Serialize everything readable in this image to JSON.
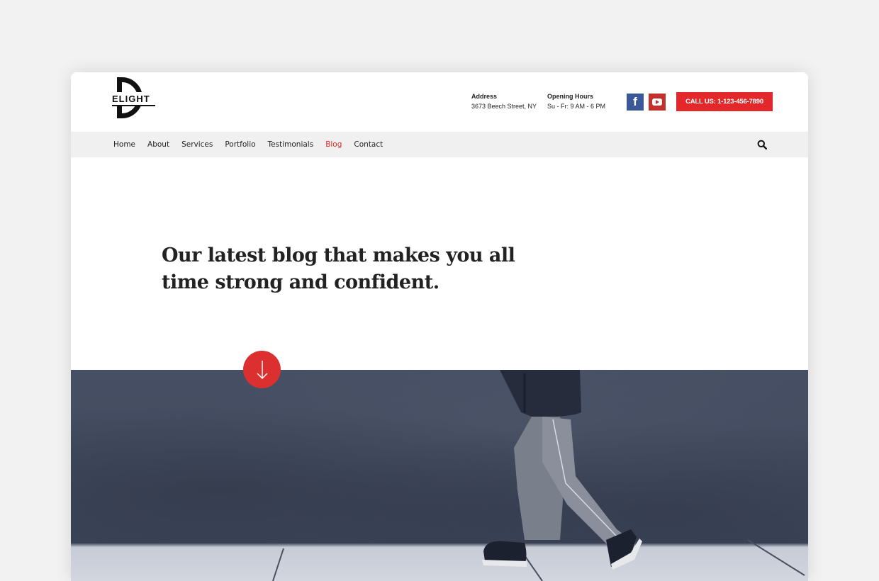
{
  "brand": {
    "logo_text": "ELIGHT",
    "logo_letter": "D"
  },
  "header": {
    "address": {
      "label": "Address",
      "value": "3673 Beech Street, NY"
    },
    "hours": {
      "label": "Opening Hours",
      "value": "Su - Fr: 9 AM - 6 PM"
    },
    "social": [
      {
        "name": "facebook-icon",
        "glyph": "f"
      },
      {
        "name": "youtube-icon",
        "glyph": ""
      }
    ],
    "call_button": "CALL US: 1-123-456-7890"
  },
  "nav": {
    "items": [
      {
        "label": "Home",
        "active": false
      },
      {
        "label": "About",
        "active": false
      },
      {
        "label": "Services",
        "active": false
      },
      {
        "label": "Portfolio",
        "active": false
      },
      {
        "label": "Testimonials",
        "active": false
      },
      {
        "label": "Blog",
        "active": true
      },
      {
        "label": "Contact",
        "active": false
      }
    ],
    "search_icon": "search-icon"
  },
  "hero": {
    "title_line1": "Our latest blog that makes you all",
    "title_line2": "time strong and confident.",
    "scroll_icon": "arrow-down-icon"
  },
  "colors": {
    "accent": "#e3282b",
    "facebook": "#3b5998",
    "youtube": "#c4302b",
    "nav_bg": "#f0f0f0",
    "page_bg": "#f2f2f2"
  }
}
